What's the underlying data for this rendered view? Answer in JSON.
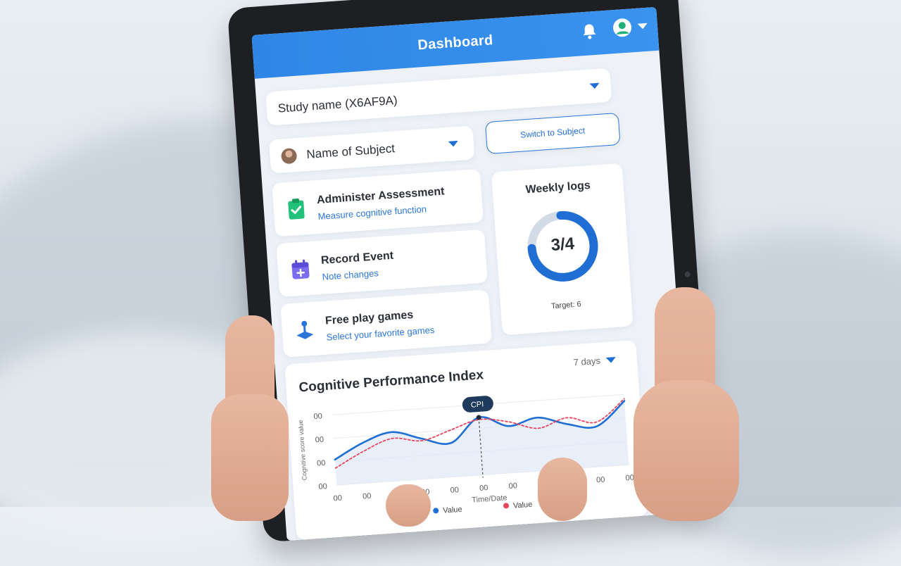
{
  "header": {
    "title": "Dashboard"
  },
  "study": {
    "label": "Study name (X6AF9A)"
  },
  "subject": {
    "label": "Name of Subject",
    "switch_label": "Switch to Subject"
  },
  "actions": [
    {
      "title": "Administer Assessment",
      "subtitle": "Measure cognitive function",
      "icon": "clipboard-check-icon",
      "color": "#22c07a"
    },
    {
      "title": "Record Event",
      "subtitle": "Note changes",
      "icon": "calendar-add-icon",
      "color": "#7b6cf0"
    },
    {
      "title": "Free play games",
      "subtitle": "Select your favorite games",
      "icon": "joystick-icon",
      "color": "#2a76d8"
    }
  ],
  "weekly": {
    "title": "Weekly logs",
    "progress": "3/4",
    "progress_fraction": 0.75,
    "target": "Target: 6"
  },
  "chart_data": {
    "type": "line",
    "title": "Cognitive Performance Index",
    "range_label": "7 days",
    "xlabel": "Time/Date",
    "ylabel": "Cognitive score value",
    "x_ticks": [
      "00",
      "00",
      "00",
      "00",
      "00",
      "00",
      "00",
      "00",
      "00",
      "00",
      "00"
    ],
    "y_ticks": [
      "00",
      "00",
      "00",
      "00"
    ],
    "marker_label": "CPI",
    "series": [
      {
        "name": "Value",
        "color": "#1f6ed4",
        "style": "solid",
        "values": [
          1.2,
          1.9,
          2.3,
          1.9,
          1.6,
          2.7,
          2.2,
          2.5,
          2.1,
          1.9,
          3.0
        ]
      },
      {
        "name": "Value",
        "color": "#e8455c",
        "style": "dotted",
        "values": [
          0.8,
          1.5,
          2.0,
          1.8,
          2.2,
          2.6,
          2.4,
          2.0,
          2.4,
          2.1,
          3.1
        ]
      }
    ]
  }
}
